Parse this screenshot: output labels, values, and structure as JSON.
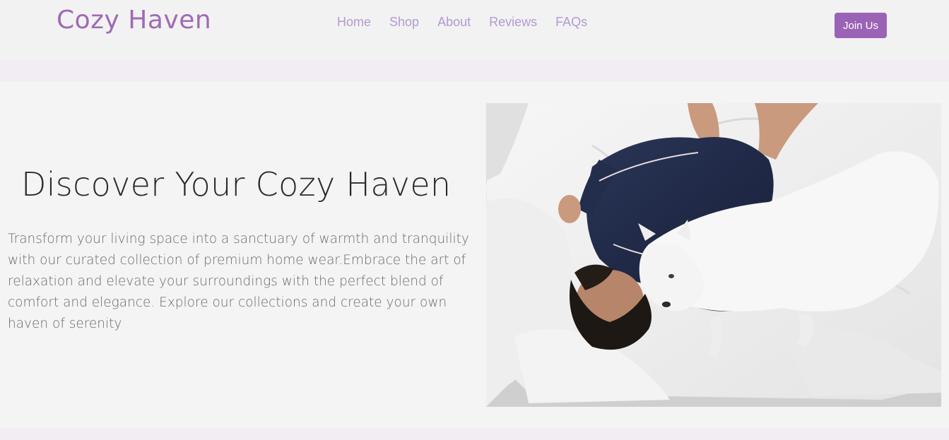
{
  "brand": {
    "name": "Cozy Haven"
  },
  "nav": {
    "links": [
      {
        "label": "Home"
      },
      {
        "label": "Shop"
      },
      {
        "label": "About"
      },
      {
        "label": "Reviews"
      },
      {
        "label": "FAQs"
      }
    ],
    "cta": "Join Us"
  },
  "hero": {
    "title": "Discover Your Cozy Haven",
    "description": "Transform your living space into a sanctuary of warmth and tranquility with our curated collection of premium home wear.Embrace the art of relaxation and elevate your surroundings with the perfect blend of comfort and elegance. Explore our collections and create your own haven of serenity",
    "image": {
      "subject": "woman-in-navy-pajamas-with-white-dog-on-bed"
    }
  },
  "colors": {
    "brand": "#a06ab4",
    "nav_link": "#b39ad0",
    "button": "#9b63b6",
    "band": "#f1edf3"
  }
}
